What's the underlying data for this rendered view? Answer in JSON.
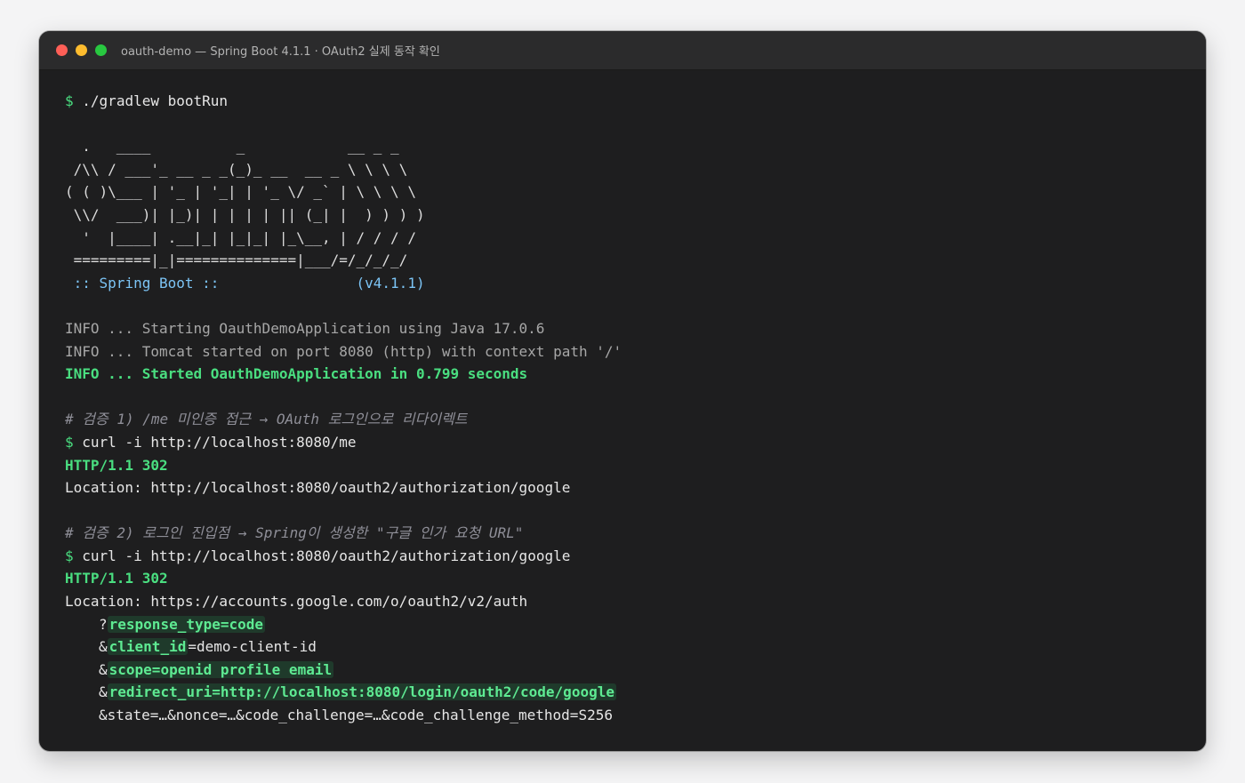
{
  "window": {
    "title": "oauth-demo — Spring Boot 4.1.1 · OAuth2 실제 동작 확인"
  },
  "terminal": {
    "prompt": "$",
    "cmd1": "./gradlew bootRun",
    "banner": [
      "  .   ____          _            __ _ _",
      " /\\\\ / ___'_ __ _ _(_)_ __  __ _ \\ \\ \\ \\",
      "( ( )\\___ | '_ | '_| | '_ \\/ _` | \\ \\ \\ \\",
      " \\\\/  ___)| |_)| | | | | || (_| |  ) ) ) )",
      "  '  |____| .__|_| |_|_| |_\\__, | / / / /",
      " =========|_|==============|___/=/_/_/_/"
    ],
    "boot_label": " :: Spring Boot ::                (v4.1.1)",
    "log1": "INFO ... Starting OauthDemoApplication using Java 17.0.6",
    "log2": "INFO ... Tomcat started on port 8080 (http) with context path '/'",
    "log3": "INFO ... Started OauthDemoApplication in 0.799 seconds",
    "comment1": "# 검증 1) /me 미인증 접근 → OAuth 로그인으로 리다이렉트",
    "cmd2": "curl -i http://localhost:8080/me",
    "status1": "HTTP/1.1 302",
    "location1": "Location: http://localhost:8080/oauth2/authorization/google",
    "comment2": "# 검증 2) 로그인 진입점 → Spring이 생성한 \"구글 인가 요청 URL\"",
    "cmd3": "curl -i http://localhost:8080/oauth2/authorization/google",
    "status2": "HTTP/1.1 302",
    "location2": "Location: https://accounts.google.com/o/oauth2/v2/auth",
    "params": {
      "p1_prefix": "?",
      "p1_hl": "response_type=code",
      "p2_prefix": "&",
      "p2_hl": "client_id",
      "p2_rest": "=demo-client-id",
      "p3_prefix": "&",
      "p3_hl": "scope=openid profile email",
      "p4_prefix": "&",
      "p4_hl": "redirect_uri=http://localhost:8080/login/oauth2/code/google",
      "p5": "&state=…&nonce=…&code_challenge=…&code_challenge_method=S256"
    }
  },
  "colors": {
    "prompt": "#4ade80",
    "boot": "#7cc4f5",
    "comment": "#8f8f98",
    "highlight_bg": "#1f3a2b"
  }
}
